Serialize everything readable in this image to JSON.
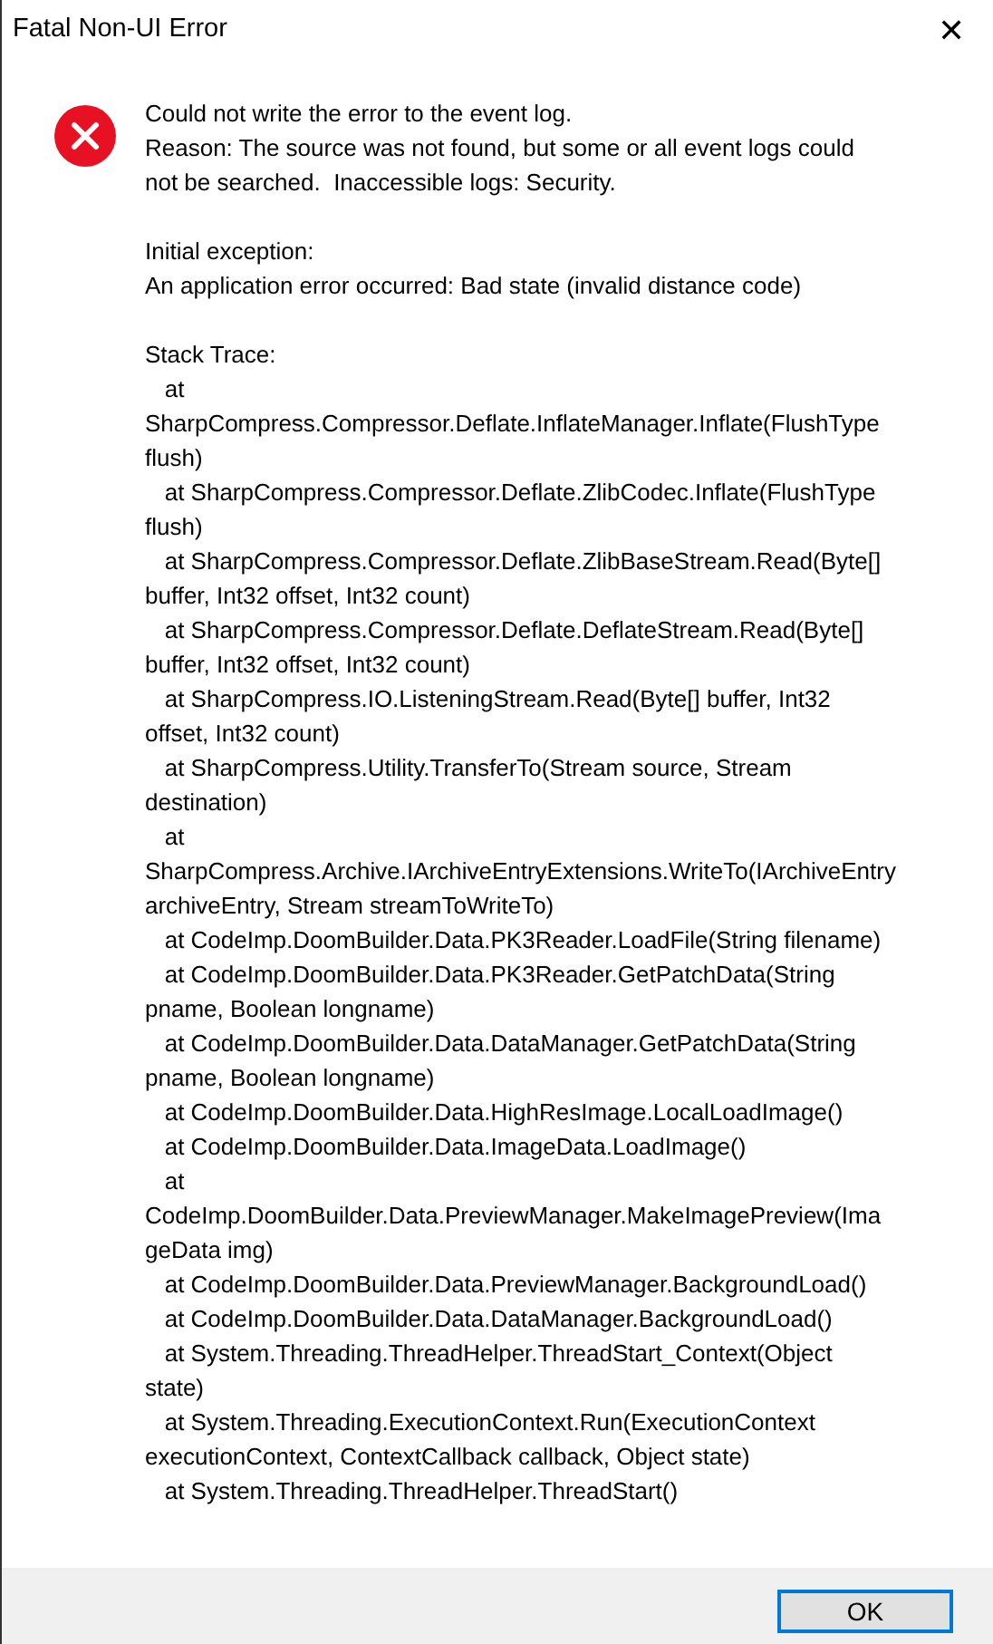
{
  "window": {
    "title": "Fatal Non-UI Error",
    "close": "✕"
  },
  "message": "Could not write the error to the event log.\nReason: The source was not found, but some or all event logs could\nnot be searched.  Inaccessible logs: Security.",
  "initial_exception": "Initial exception:\nAn application error occurred: Bad state (invalid distance code)",
  "stack_trace": "Stack Trace:\n   at\nSharpCompress.Compressor.Deflate.InflateManager.Inflate(FlushType\nflush)\n   at SharpCompress.Compressor.Deflate.ZlibCodec.Inflate(FlushType\nflush)\n   at SharpCompress.Compressor.Deflate.ZlibBaseStream.Read(Byte[]\nbuffer, Int32 offset, Int32 count)\n   at SharpCompress.Compressor.Deflate.DeflateStream.Read(Byte[]\nbuffer, Int32 offset, Int32 count)\n   at SharpCompress.IO.ListeningStream.Read(Byte[] buffer, Int32\noffset, Int32 count)\n   at SharpCompress.Utility.TransferTo(Stream source, Stream\ndestination)\n   at\nSharpCompress.Archive.IArchiveEntryExtensions.WriteTo(IArchiveEntry\narchiveEntry, Stream streamToWriteTo)\n   at CodeImp.DoomBuilder.Data.PK3Reader.LoadFile(String filename)\n   at CodeImp.DoomBuilder.Data.PK3Reader.GetPatchData(String\npname, Boolean longname)\n   at CodeImp.DoomBuilder.Data.DataManager.GetPatchData(String\npname, Boolean longname)\n   at CodeImp.DoomBuilder.Data.HighResImage.LocalLoadImage()\n   at CodeImp.DoomBuilder.Data.ImageData.LoadImage()\n   at\nCodeImp.DoomBuilder.Data.PreviewManager.MakeImagePreview(Ima\ngeData img)\n   at CodeImp.DoomBuilder.Data.PreviewManager.BackgroundLoad()\n   at CodeImp.DoomBuilder.Data.DataManager.BackgroundLoad()\n   at System.Threading.ThreadHelper.ThreadStart_Context(Object\nstate)\n   at System.Threading.ExecutionContext.Run(ExecutionContext\nexecutionContext, ContextCallback callback, Object state)\n   at System.Threading.ThreadHelper.ThreadStart()",
  "buttons": [
    {
      "label": "OK",
      "selected": true
    }
  ]
}
